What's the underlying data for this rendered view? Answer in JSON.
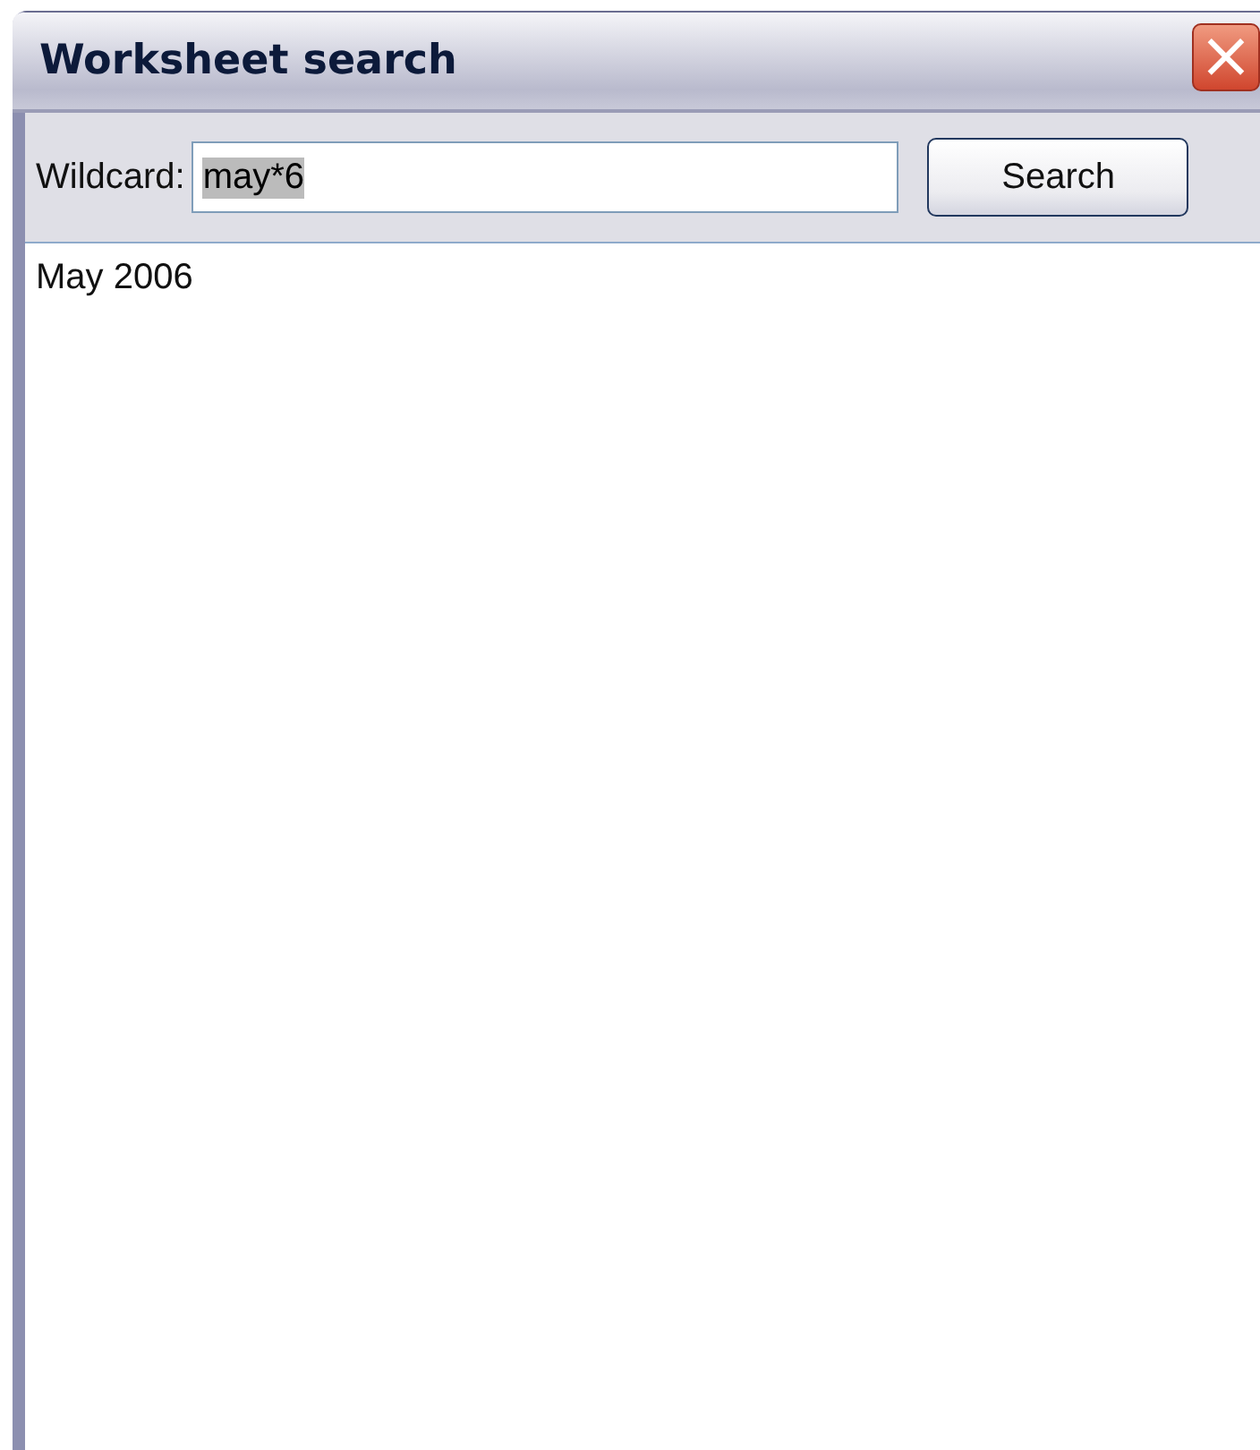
{
  "window": {
    "title": "Worksheet search",
    "close_icon": "×"
  },
  "search_bar": {
    "label": "Wildcard:",
    "value": "may*6",
    "value_highlighted": true,
    "button": "Search"
  },
  "results": [
    "May 2006"
  ]
}
